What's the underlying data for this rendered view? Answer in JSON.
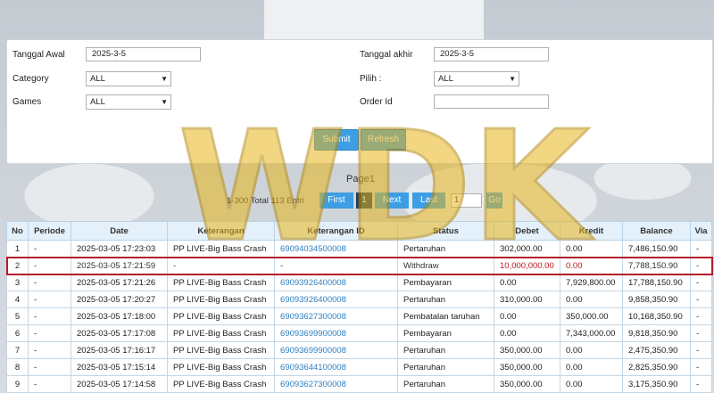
{
  "filters": {
    "start_date_label": "Tanggal Awal",
    "start_date_value": "2025-3-5",
    "end_date_label": "Tanggal akhir",
    "end_date_value": "2025-3-5",
    "category_label": "Category",
    "category_value": "ALL",
    "pilih_label": "Pilih  :",
    "pilih_value": "ALL",
    "games_label": "Games",
    "games_value": "ALL",
    "order_id_label": "Order Id",
    "order_id_value": "",
    "submit_label": "Submit",
    "refresh_label": "Refresh"
  },
  "pagination": {
    "page_title": "Page1",
    "summary": "1-300 Total 113 Entri",
    "first_label": "First",
    "current_page": "1",
    "next_label": "Next",
    "last_label": "Last",
    "page_input": "1",
    "go_label": "Go"
  },
  "table": {
    "columns": [
      "No",
      "Periode",
      "Date",
      "Keterangan",
      "Keterangan ID",
      "Status",
      "Debet",
      "Kredit",
      "Balance",
      "Via"
    ],
    "rows": [
      {
        "no": "1",
        "periode": "-",
        "date": "2025-03-05 17:23:03",
        "ket": "PP LIVE-Big Bass Crash",
        "ket_id": "69094034500008",
        "status": "Pertaruhan",
        "debet": "302,000.00",
        "kredit": "0.00",
        "balance": "7,486,150.90",
        "via": "-"
      },
      {
        "no": "2",
        "periode": "-",
        "date": "2025-03-05 17:21:59",
        "ket": "-",
        "ket_id": "-",
        "status": "Withdraw",
        "debet": "10,000,000.00",
        "kredit": "0.00",
        "balance": "7,788,150.90",
        "via": "-"
      },
      {
        "no": "3",
        "periode": "-",
        "date": "2025-03-05 17:21:26",
        "ket": "PP LIVE-Big Bass Crash",
        "ket_id": "69093926400008",
        "status": "Pembayaran",
        "debet": "0.00",
        "kredit": "7,929,800.00",
        "balance": "17,788,150.90",
        "via": "-"
      },
      {
        "no": "4",
        "periode": "-",
        "date": "2025-03-05 17:20:27",
        "ket": "PP LIVE-Big Bass Crash",
        "ket_id": "69093926400008",
        "status": "Pertaruhan",
        "debet": "310,000.00",
        "kredit": "0.00",
        "balance": "9,858,350.90",
        "via": "-"
      },
      {
        "no": "5",
        "periode": "-",
        "date": "2025-03-05 17:18:00",
        "ket": "PP LIVE-Big Bass Crash",
        "ket_id": "69093627300008",
        "status": "Pembatalan taruhan",
        "debet": "0.00",
        "kredit": "350,000.00",
        "balance": "10,168,350.90",
        "via": "-"
      },
      {
        "no": "6",
        "periode": "-",
        "date": "2025-03-05 17:17:08",
        "ket": "PP LIVE-Big Bass Crash",
        "ket_id": "69093699900008",
        "status": "Pembayaran",
        "debet": "0.00",
        "kredit": "7,343,000.00",
        "balance": "9,818,350.90",
        "via": "-"
      },
      {
        "no": "7",
        "periode": "-",
        "date": "2025-03-05 17:16:17",
        "ket": "PP LIVE-Big Bass Crash",
        "ket_id": "69093699900008",
        "status": "Pertaruhan",
        "debet": "350,000.00",
        "kredit": "0.00",
        "balance": "2,475,350.90",
        "via": "-"
      },
      {
        "no": "8",
        "periode": "-",
        "date": "2025-03-05 17:15:14",
        "ket": "PP LIVE-Big Bass Crash",
        "ket_id": "69093644100008",
        "status": "Pertaruhan",
        "debet": "350,000.00",
        "kredit": "0.00",
        "balance": "2,825,350.90",
        "via": "-"
      },
      {
        "no": "9",
        "periode": "-",
        "date": "2025-03-05 17:14:58",
        "ket": "PP LIVE-Big Bass Crash",
        "ket_id": "69093627300008",
        "status": "Pertaruhan",
        "debet": "350,000.00",
        "kredit": "0.00",
        "balance": "3,175,350.90",
        "via": "-"
      }
    ]
  },
  "watermark_text": "WDK",
  "colors": {
    "accent": "#3d9ee4",
    "highlight_border": "#b21e2a",
    "debit_red": "#c0161e",
    "link": "#2f7fc1",
    "watermark": "#e8b61c"
  }
}
